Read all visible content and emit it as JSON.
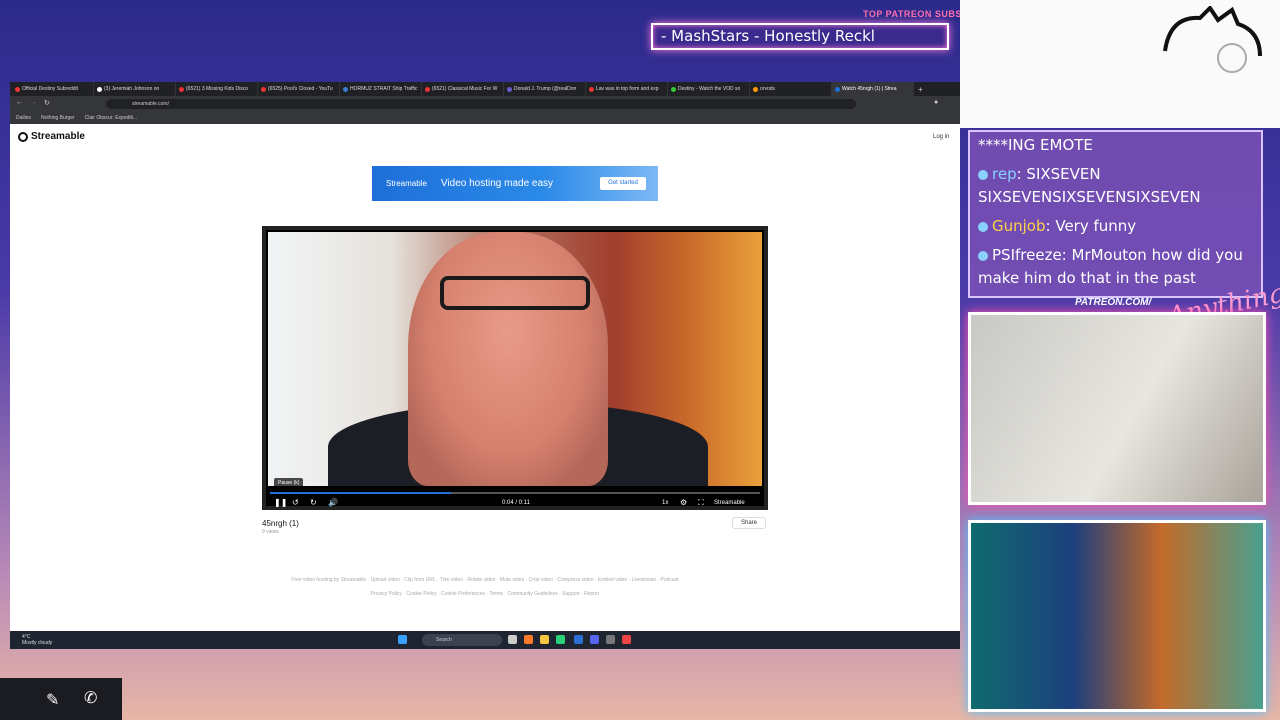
{
  "overlay": {
    "patreon_title": "TOP PATREON SUBS",
    "patreon_ticker": "- MashStars - Honestly Reckl",
    "patreon_url": "PATREON.COM/",
    "patreon_script": "Anything Else",
    "chat": [
      {
        "user": "",
        "text": "****ING EMOTE"
      },
      {
        "user": "rep",
        "text": "SIXSEVEN SIXSEVENSIXSEVENSIXSEVEN"
      },
      {
        "user": "Gunjob",
        "text": "Very funny"
      },
      {
        "user": "PSIfreeze",
        "text": "MrMouton how did you make him do that in the past"
      }
    ]
  },
  "browser": {
    "tabs": [
      "Official Destiny Subreddit",
      "(3) Jeremiah Johnson on",
      "(6521) 3 Missing Kids Disco",
      "(6525) Pool's Closed - YouTu",
      "HORMUZ STRAIT Ship Traffic",
      "(6521) Classical Music For W",
      "Donald J. Trump (@realDon",
      "Lav was in top form and exp",
      "Destiny - Watch the VOD so",
      "orvods",
      "Watch 45nrgh (1) | Strea"
    ],
    "url": "streamable.com/",
    "bookmarks": [
      "Dailies",
      "Nothing Burger",
      "Clair Obscur: Expediti..."
    ]
  },
  "page": {
    "logo": "Streamable",
    "login": "Log in",
    "ad": {
      "brand": "Streamable",
      "headline": "Video hosting made easy",
      "cta": "Get started"
    },
    "player": {
      "tooltip": "Pause (k)",
      "time": "0:04 / 0:11",
      "progress": 0.37,
      "speed": "1x",
      "brand": "Streamable"
    },
    "video_title": "45nrgh (1)",
    "views": "9 views",
    "share": "Share",
    "footer_row1": "Free video hosting by Streamable · Upload video · Clip from URL · Trim video · Rotate video · Mute video · Crop video · Compress video · Embed video · Livestream · Podcast",
    "footer_row2": "Privacy Policy · Cookie Policy · Cookie Preferences · Terms · Community Guidelines · Support · Report"
  },
  "taskbar": {
    "weather_temp": "4°C",
    "weather_desc": "Mostly cloudy",
    "search": "Search"
  },
  "colors": {
    "accent": "#1e6fd9",
    "pink_glow": "#ff4fb0"
  }
}
